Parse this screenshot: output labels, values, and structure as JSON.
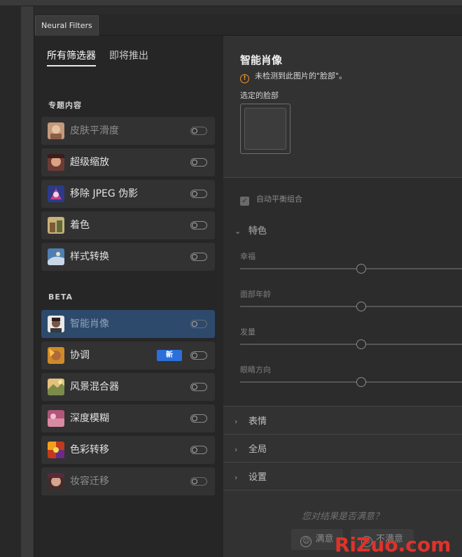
{
  "panel": {
    "tab_title": "Neural Filters"
  },
  "left": {
    "tabs": [
      {
        "label": "所有筛选器",
        "active": true
      },
      {
        "label": "即将推出",
        "active": false
      }
    ],
    "featured_header": "专题内容",
    "featured": [
      {
        "label": "皮肤平滑度",
        "icon": "skin-smoothing-thumb",
        "enabled": false
      },
      {
        "label": "超级缩放",
        "icon": "super-zoom-thumb",
        "enabled": false
      },
      {
        "label": "移除 JPEG 伪影",
        "icon": "jpeg-artifacts-thumb",
        "enabled": false
      },
      {
        "label": "着色",
        "icon": "colorize-thumb",
        "enabled": false
      },
      {
        "label": "样式转换",
        "icon": "style-transfer-thumb",
        "enabled": false
      }
    ],
    "beta_header": "BETA",
    "beta": [
      {
        "label": "智能肖像",
        "icon": "smart-portrait-thumb",
        "enabled": false
      },
      {
        "label": "协调",
        "icon": "harmonization-thumb",
        "enabled": false,
        "badge": "新"
      },
      {
        "label": "风景混合器",
        "icon": "landscape-mixer-thumb",
        "enabled": false
      },
      {
        "label": "深度模糊",
        "icon": "depth-blur-thumb",
        "enabled": false
      },
      {
        "label": "色彩转移",
        "icon": "color-transfer-thumb",
        "enabled": false
      },
      {
        "label": "妆容迁移",
        "icon": "makeup-transfer-thumb",
        "enabled": false
      }
    ]
  },
  "right": {
    "title": "智能肖像",
    "warning": "未检测到此图片的\"脸部\"。",
    "selected_face_label": "选定的脸部",
    "auto_balance_label": "自动平衡组合",
    "auto_balance_checked": true,
    "features_header": "特色",
    "sliders": [
      {
        "label": "幸福",
        "value": 0
      },
      {
        "label": "面部年龄",
        "value": 0
      },
      {
        "label": "发量",
        "value": 0
      },
      {
        "label": "眼睛方向",
        "value": 0
      }
    ],
    "collapsed_sections": [
      "表情",
      "全局",
      "设置"
    ],
    "feedback_question": "您对结果是否满意？",
    "satisfied_label": "满意",
    "unsatisfied_label": "不满意"
  },
  "watermark": "RiZuo.com",
  "colors": {
    "selected_row": "#2d4a6d",
    "badge": "#2c6fda",
    "warning": "#f29423",
    "watermark": "#e0322a"
  }
}
